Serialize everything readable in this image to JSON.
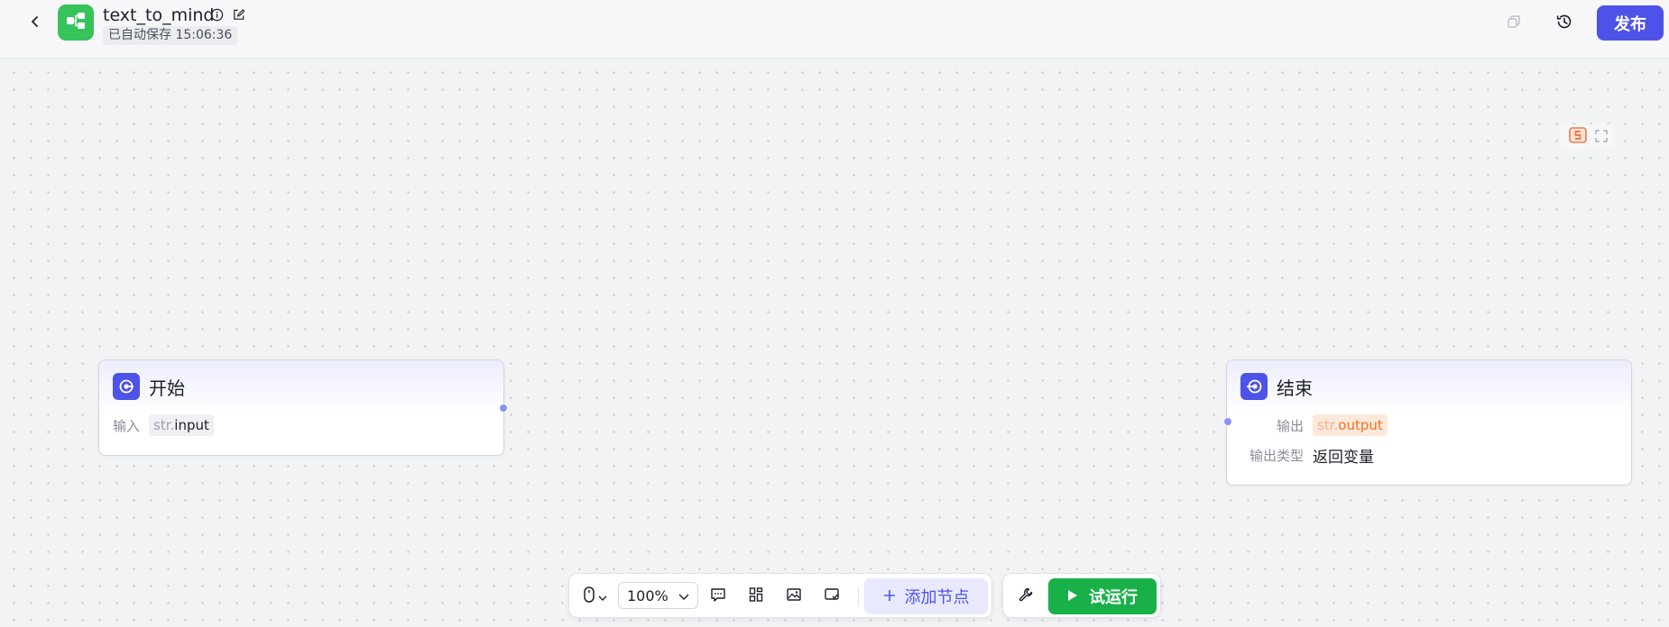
{
  "header": {
    "app_title": "text_to_mind",
    "autosave_text": "已自动保存 15:06:36",
    "publish_label": "发布"
  },
  "nodes": {
    "start": {
      "title": "开始",
      "input_label": "输入",
      "input_type": "str.",
      "input_name": "input"
    },
    "end": {
      "title": "结束",
      "output_label": "输出",
      "output_type": "str.",
      "output_name": "output",
      "output_kind_label": "输出类型",
      "output_kind_value": "返回变量"
    }
  },
  "toolbar": {
    "zoom": "100%",
    "add_node_label": "添加节点",
    "run_label": "试运行"
  },
  "colors": {
    "brand": "#4d53e8",
    "run_green": "#19b04a",
    "app_logo_green": "#36c35a",
    "port": "#8d91f3"
  },
  "icons": [
    "back-icon",
    "workflow-icon",
    "info-icon",
    "edit-icon",
    "copy-icon",
    "history-icon",
    "minimap-logo-icon",
    "fullscreen-icon",
    "start-node-icon",
    "end-node-icon",
    "mouse-icon",
    "comment-icon",
    "layout-icon",
    "image-icon",
    "minimap-toggle-icon",
    "plus-icon",
    "wrench-icon",
    "play-icon"
  ]
}
